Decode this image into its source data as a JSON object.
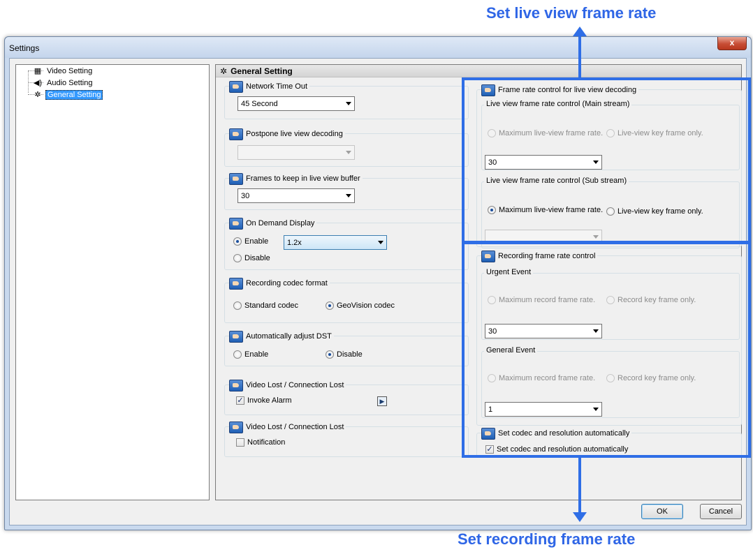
{
  "annotations": {
    "top_callout": "Set live view frame rate",
    "bottom_callout": "Set recording frame rate",
    "accent_color": "#2f6ee6"
  },
  "window": {
    "title": "Settings",
    "close_label": "x"
  },
  "tree": {
    "items": [
      {
        "label": "Video Setting",
        "icon": "film-icon"
      },
      {
        "label": "Audio Setting",
        "icon": "speaker-icon"
      },
      {
        "label": "General Setting",
        "icon": "gear-icon",
        "selected": true
      }
    ]
  },
  "panel": {
    "header": "General Setting",
    "network_timeout": {
      "title": "Network Time Out",
      "value": "45 Second"
    },
    "postpone": {
      "title": "Postpone live view decoding",
      "value": ""
    },
    "frames_buffer": {
      "title": "Frames to keep in live view buffer",
      "value": "30"
    },
    "on_demand": {
      "title": "On Demand Display",
      "enable": "Enable",
      "disable": "Disable",
      "value": "1.2x",
      "selected": "Enable"
    },
    "codec": {
      "title": "Recording codec format",
      "standard": "Standard codec",
      "geovision": "GeoVision codec",
      "selected": "GeoVision codec"
    },
    "dst": {
      "title": "Automatically adjust DST",
      "enable": "Enable",
      "disable": "Disable",
      "selected": "Disable"
    },
    "video_lost_1": {
      "title": "Video Lost / Connection Lost",
      "checkbox": "Invoke Alarm",
      "checked": true
    },
    "video_lost_2": {
      "title": "Video Lost / Connection Lost",
      "checkbox": "Notification",
      "checked": false
    },
    "live_frame": {
      "title": "Frame rate control for live view decoding",
      "main": {
        "title": "Live view frame rate control (Main stream)",
        "max": "Maximum live-view frame rate.",
        "key": "Live-view key frame only.",
        "value": "30"
      },
      "sub": {
        "title": "Live view frame rate control (Sub stream)",
        "max": "Maximum live-view frame rate.",
        "key": "Live-view key frame only.",
        "value": ""
      }
    },
    "record_frame": {
      "title": "Recording frame rate control",
      "urgent": {
        "title": "Urgent Event",
        "max": "Maximum record frame rate.",
        "key": "Record key frame only.",
        "value": "30"
      },
      "general": {
        "title": "General Event",
        "max": "Maximum record frame rate.",
        "key": "Record key frame only.",
        "value": "1"
      }
    },
    "auto_codec": {
      "title": "Set codec and resolution automatically",
      "checkbox": "Set codec and resolution automatically",
      "checked": true
    }
  },
  "buttons": {
    "ok": "OK",
    "cancel": "Cancel"
  }
}
